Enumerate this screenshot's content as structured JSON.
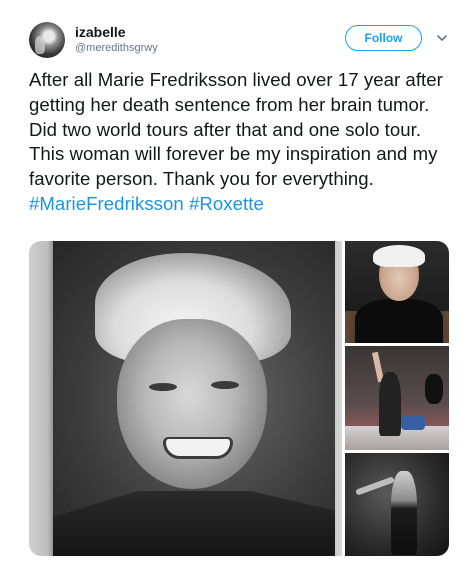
{
  "user": {
    "display_name": "izabelle",
    "handle": "@meredithsgrwy"
  },
  "actions": {
    "follow_label": "Follow"
  },
  "tweet": {
    "text": "After all Marie Fredriksson lived over 17 year after getting her death sentence from her brain tumor. Did two world tours after that and one solo tour. This woman will forever be my inspiration and my favorite person. Thank you for everything.",
    "hashtags": [
      "#MarieFredriksson",
      "#Roxette"
    ]
  },
  "colors": {
    "accent": "#1da1f2",
    "hashtag": "#1b95e0",
    "text": "#14171a",
    "muted": "#657786"
  },
  "icons": {
    "caret": "chevron-down-icon"
  }
}
